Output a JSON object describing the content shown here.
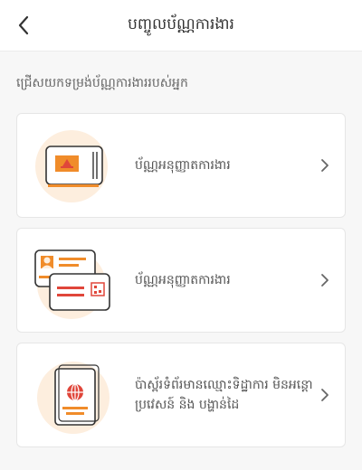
{
  "header": {
    "title": "បញ្ចូលប័ណ្ណការងារ"
  },
  "subtitle": "ជ្រើសយកទម្រង់ប័ណ្ណការងាររបស់អ្នក",
  "options": [
    {
      "label": "ប័ណ្ណអនុញ្ញាតការងារ"
    },
    {
      "label": "ប័ណ្ណអនុញ្ញាតការងារ"
    },
    {
      "label": "ប៉ាស្ព័រទំព័រមានឈ្មោះទិដ្ឋាការ មិនអន្តោប្រវេសន៍ និង បង្ហាន់ដៃ"
    }
  ],
  "colors": {
    "accent": "#f08c2a",
    "red": "#e0463a",
    "illustration_bg": "#fdeede"
  }
}
